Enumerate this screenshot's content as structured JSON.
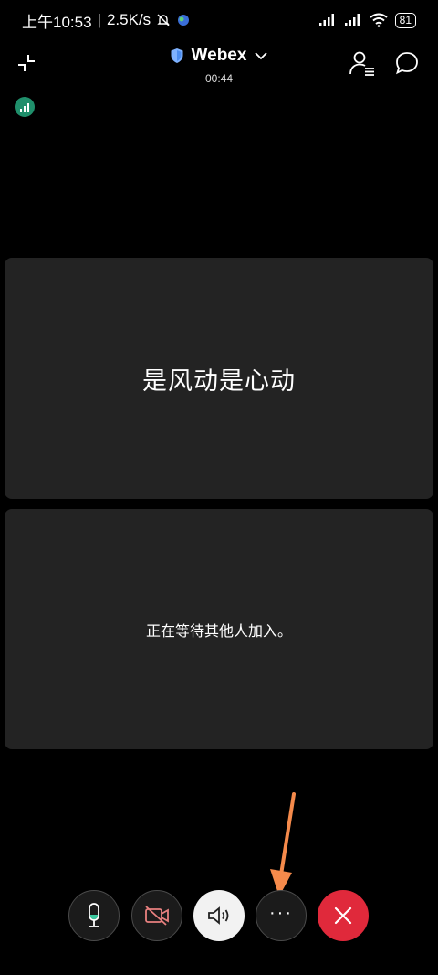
{
  "status_bar": {
    "time": "上午10:53",
    "speed": "2.5K/s",
    "battery": "81"
  },
  "header": {
    "title": "Webex",
    "timer": "00:44"
  },
  "tiles": {
    "main_name": "是风动是心动",
    "waiting_message": "正在等待其他人加入。"
  },
  "controls": {
    "more_label": "···"
  },
  "colors": {
    "background": "#000000",
    "tile": "#232323",
    "end_call": "#e0293b",
    "signal": "#1f8f6b",
    "mic_accent": "#3cc9a0",
    "video_off": "#e8807f",
    "annotation_arrow": "#f58a4b"
  },
  "icons": {
    "collapse": "collapse-icon",
    "shield": "shield-icon",
    "dropdown": "chevron-down-icon",
    "participants": "participants-icon",
    "chat": "chat-icon",
    "signal": "signal-strength-icon",
    "mute": "microphone-icon",
    "video": "video-off-icon",
    "audio": "speaker-icon",
    "end": "close-icon"
  }
}
